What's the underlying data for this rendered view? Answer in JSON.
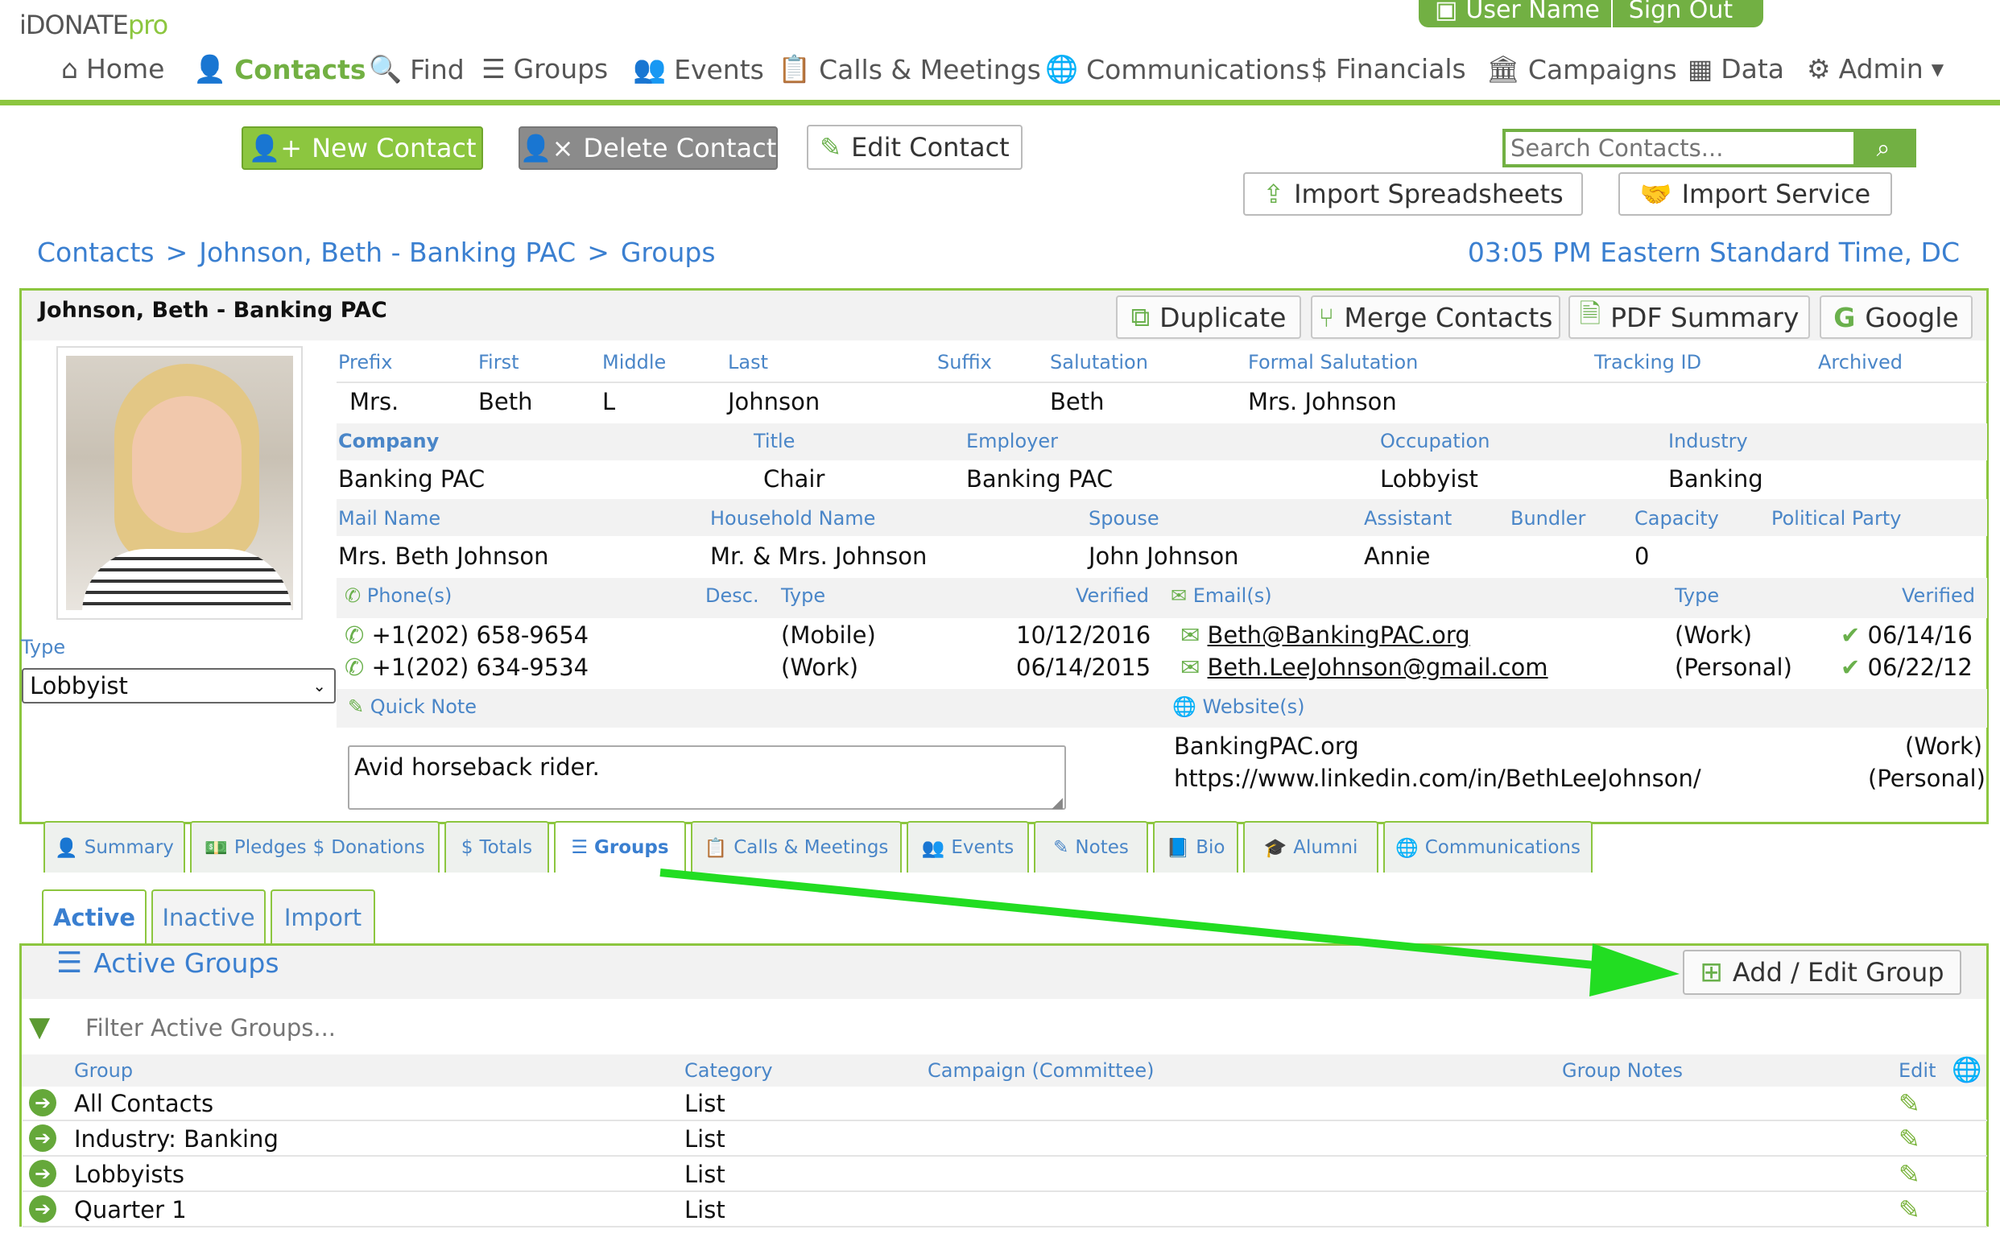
{
  "brand": {
    "name": "iDONATE",
    "suffix": "pro"
  },
  "top_buttons": {
    "user": "User Name",
    "signout": "Sign Out"
  },
  "nav": [
    {
      "label": "Home",
      "icon": "home-icon"
    },
    {
      "label": "Contacts",
      "icon": "user-icon"
    },
    {
      "label": "Find",
      "icon": "search-icon"
    },
    {
      "label": "Groups",
      "icon": "list-icon"
    },
    {
      "label": "Events",
      "icon": "people-icon"
    },
    {
      "label": "Calls & Meetings",
      "icon": "clipboard-icon"
    },
    {
      "label": "Communications",
      "icon": "globe-icon"
    },
    {
      "label": "Financials",
      "icon": "dollar-icon"
    },
    {
      "label": "Campaigns",
      "icon": "bank-icon"
    },
    {
      "label": "Data",
      "icon": "table-icon"
    },
    {
      "label": "Admin",
      "icon": "cogs-icon"
    }
  ],
  "actions": {
    "new": "New Contact",
    "delete": "Delete Contact",
    "edit": "Edit Contact",
    "search_placeholder": "Search Contacts...",
    "import_sheets": "Import Spreadsheets",
    "import_service": "Import Service"
  },
  "breadcrumb": {
    "a": "Contacts",
    "b": "Johnson, Beth - Banking PAC",
    "c": "Groups",
    "sep": ">"
  },
  "time": "03:05 PM Eastern Standard Time, DC",
  "contact": {
    "title": "Johnson, Beth - Banking PAC",
    "tools": {
      "duplicate": "Duplicate",
      "merge": "Merge Contacts",
      "pdf": "PDF Summary",
      "google": "Google"
    },
    "labels": {
      "prefix": "Prefix",
      "first": "First",
      "middle": "Middle",
      "last": "Last",
      "suffix": "Suffix",
      "salutation": "Salutation",
      "formal": "Formal Salutation",
      "tracking": "Tracking ID",
      "archived": "Archived",
      "company": "Company",
      "title": "Title",
      "employer": "Employer",
      "occupation": "Occupation",
      "industry": "Industry",
      "mail": "Mail Name",
      "household": "Household Name",
      "spouse": "Spouse",
      "assistant": "Assistant",
      "bundler": "Bundler",
      "capacity": "Capacity",
      "party": "Political Party",
      "phones": "Phone(s)",
      "desc": "Desc.",
      "ptype": "Type",
      "pverified": "Verified",
      "emails": "Email(s)",
      "etype": "Type",
      "everified": "Verified",
      "quicknote": "Quick Note",
      "websites": "Website(s)",
      "type": "Type"
    },
    "prefix": "Mrs.",
    "first": "Beth",
    "middle": "L",
    "last": "Johnson",
    "salutation": "Beth",
    "formal": "Mrs. Johnson",
    "company": "Banking PAC",
    "title_val": "Chair",
    "employer": "Banking PAC",
    "occupation": "Lobbyist",
    "industry": "Banking",
    "mail": "Mrs. Beth Johnson",
    "household": "Mr. & Mrs. Johnson",
    "spouse": "John Johnson",
    "assistant": "Annie",
    "capacity": "0",
    "phones": [
      {
        "number": "+1(202) 658-9654",
        "type": "(Mobile)",
        "verified": "10/12/2016"
      },
      {
        "number": "+1(202) 634-9534",
        "type": "(Work)",
        "verified": "06/14/2015"
      }
    ],
    "emails": [
      {
        "address": "Beth@BankingPAC.org",
        "type": "(Work)",
        "verified": "06/14/16"
      },
      {
        "address": "Beth.LeeJohnson@gmail.com",
        "type": "(Personal)",
        "verified": "06/22/12"
      }
    ],
    "note": "Avid horseback rider.",
    "websites": [
      {
        "url": "BankingPAC.org",
        "type": "(Work)"
      },
      {
        "url": "https://www.linkedin.com/in/BethLeeJohnson/",
        "type": "(Personal)"
      }
    ],
    "type_select": "Lobbyist"
  },
  "tabs": [
    {
      "label": "Summary"
    },
    {
      "label": "Pledges"
    },
    {
      "label": "Donations"
    },
    {
      "label": "Totals"
    },
    {
      "label": "Groups"
    },
    {
      "label": "Calls & Meetings"
    },
    {
      "label": "Events"
    },
    {
      "label": "Notes"
    },
    {
      "label": "Bio"
    },
    {
      "label": "Alumni"
    },
    {
      "label": "Communications"
    }
  ],
  "subtabs": {
    "active": "Active",
    "inactive": "Inactive",
    "import": "Import"
  },
  "groups": {
    "heading": "Active Groups",
    "add": "Add / Edit Group",
    "filter_placeholder": "Filter Active Groups...",
    "cols": {
      "group": "Group",
      "category": "Category",
      "campaign": "Campaign (Committee)",
      "notes": "Group Notes",
      "edit": "Edit"
    },
    "rows": [
      {
        "group": "All Contacts",
        "category": "List"
      },
      {
        "group": "Industry: Banking",
        "category": "List"
      },
      {
        "group": "Lobbyists",
        "category": "List"
      },
      {
        "group": "Quarter 1",
        "category": "List"
      }
    ]
  },
  "colors": {
    "green": "#8cc63f",
    "blue": "#4a86c8",
    "arrow": "#22dd22"
  }
}
